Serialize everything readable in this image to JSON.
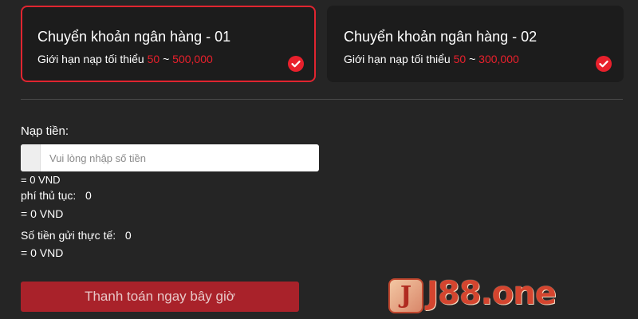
{
  "cards": [
    {
      "title": "Chuyển khoản ngân hàng - 01",
      "limit_prefix": "Giới hạn nạp tối thiểu",
      "limit_min": "50",
      "limit_sep": "~",
      "limit_max": "500,000",
      "selected": true
    },
    {
      "title": "Chuyển khoản ngân hàng - 02",
      "limit_prefix": "Giới hạn nạp tối thiểu",
      "limit_min": "50",
      "limit_sep": "~",
      "limit_max": "300,000",
      "selected": false
    }
  ],
  "deposit": {
    "label": "Nạp tiền:",
    "placeholder": "Vui lòng nhập số tiền",
    "value": "",
    "converted": "= 0 VND"
  },
  "fee": {
    "label": "phí thủ tục:",
    "value": "0",
    "converted": "= 0 VND"
  },
  "actual": {
    "label": "Số tiền gửi thực tế:",
    "value": "0",
    "converted": "= 0 VND"
  },
  "pay_button": "Thanh toán ngay bây giờ",
  "logo": {
    "mark": "J",
    "text": "J88.one"
  },
  "colors": {
    "accent": "#e02530",
    "background": "#252525",
    "card": "#1c1c1c",
    "button": "#a9222a",
    "logo": "#d4452f"
  },
  "icons": {
    "check": "check-circle-icon"
  }
}
